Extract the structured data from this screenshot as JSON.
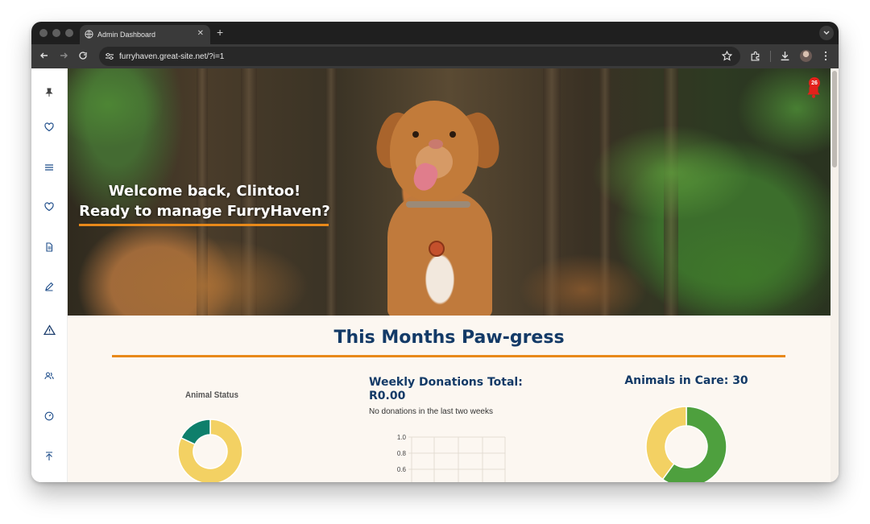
{
  "browser": {
    "tab_title": "Admin Dashboard",
    "url": "furryhaven.great-site.net/?i=1"
  },
  "sidebar": {
    "items": [
      {
        "icon": "pin-icon"
      },
      {
        "icon": "heart-icon"
      },
      {
        "icon": "menu-icon"
      },
      {
        "icon": "heart-icon"
      },
      {
        "icon": "document-icon"
      },
      {
        "icon": "pencil-icon"
      },
      {
        "icon": "warning-icon"
      },
      {
        "icon": "users-icon"
      },
      {
        "icon": "dashboard-icon"
      },
      {
        "icon": "arrow-up-icon"
      }
    ]
  },
  "hero": {
    "welcome_line1": "Welcome back, Clintoo!",
    "welcome_line2": "Ready to manage FurryHaven?",
    "notification_count": "26"
  },
  "progress": {
    "title": "This Months Paw-gress",
    "animal_status": {
      "chart_title": "Animal Status",
      "chart_data": {
        "type": "pie",
        "title": "Animal Status",
        "values": [
          0.82,
          0.18
        ],
        "colors": [
          "#f3d163",
          "#0e7f6b"
        ]
      }
    },
    "donations": {
      "title": "Weekly Donations Total: R0.00",
      "title_line1": "Weekly Donations Total:",
      "title_line2": "R0.00",
      "subtitle": "No donations in the last two weeks",
      "chart_data": {
        "type": "line",
        "y_ticks": [
          "1.0",
          "0.8",
          "0.6"
        ],
        "ylim": [
          0,
          1.0
        ],
        "grid": true
      }
    },
    "animals_in_care": {
      "title": "Animals in Care: 30",
      "chart_data": {
        "type": "pie",
        "values": [
          0.6,
          0.4
        ],
        "colors": [
          "#4ea03e",
          "#f3d163"
        ]
      }
    }
  },
  "colors": {
    "accent": "#e8891a",
    "title": "#133a67",
    "background": "#fcf7f1"
  }
}
